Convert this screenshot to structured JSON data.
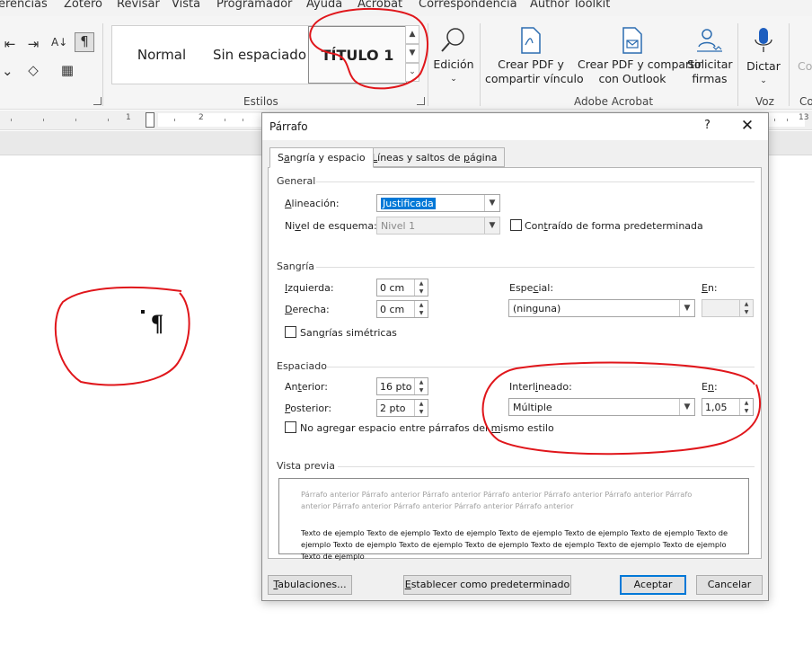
{
  "ribbon_tabs": [
    "erencias",
    "Zotero",
    "Revisar",
    "Vista",
    "Programador",
    "Ayuda",
    "Acrobat",
    "Correspondencia",
    "Author Toolkit"
  ],
  "styles": {
    "items": [
      "Normal",
      "Sin espaciado",
      "TÍTULO 1"
    ],
    "group_label": "Estilos"
  },
  "editing": {
    "label": "Edición"
  },
  "acrobat": {
    "crear_pdf": [
      "Crear PDF y",
      "compartir vínculo"
    ],
    "crear_outlook": [
      "Crear PDF y compartir",
      "con Outlook"
    ],
    "solicitar": [
      "Solicitar",
      "firmas"
    ],
    "group_label": "Adobe Acrobat"
  },
  "voice": {
    "dictar": "Dictar",
    "group_label": "Voz",
    "cut_label": "Co",
    "cut_label2": "Co"
  },
  "ruler": {
    "left_num": "1",
    "right_num": "13",
    "n2": "2"
  },
  "document": {
    "pilcrow": "¶"
  },
  "dialog": {
    "title": "Párrafo",
    "help": "?",
    "close": "✕",
    "tabs": {
      "indent_pre": "S",
      "indent_u": "a",
      "indent_post": "ngría y espacio",
      "lines_pre": "L",
      "lines_u": "í",
      "lines_post": "neas y saltos de ",
      "lines_u2": "p",
      "lines_post2": "ágina"
    },
    "general": {
      "heading": "General",
      "alignment_label_u": "A",
      "alignment_label": "lineación:",
      "alignment_value": "Justificada",
      "outline_label_pre": "Ni",
      "outline_label_u": "v",
      "outline_label": "el de esquema:",
      "outline_value": "Nivel 1",
      "collapsed_pre": "Con",
      "collapsed_u": "t",
      "collapsed_label": "raído de forma predeterminada"
    },
    "indent": {
      "heading": "Sangría",
      "left_label_u": "I",
      "left_label": "zquierda:",
      "left_value": "0 cm",
      "right_label_u": "D",
      "right_label": "erecha:",
      "right_value": "0 cm",
      "special_label_pre": "Espe",
      "special_label_u": "c",
      "special_label": "ial:",
      "special_value": "(ninguna)",
      "by_label_u": "E",
      "by_label": "n:",
      "mirror_pre": "San",
      "mirror_u": "g",
      "mirror_label": "rías simétricas"
    },
    "spacing": {
      "heading": "Espaciado",
      "before_label_pre": "An",
      "before_label_u": "t",
      "before_label": "erior:",
      "before_value": "16 pto",
      "after_label_u": "P",
      "after_label": "osterior:",
      "after_value": "2 pto",
      "line_label_pre": "Interl",
      "line_label_u": "i",
      "line_label": "neado:",
      "line_value": "Múltiple",
      "at_label_pre": "E",
      "at_label_u": "n",
      "at_label": ":",
      "at_value": "1,05",
      "nospace_pre": "No agregar espacio entre párrafos del ",
      "nospace_u": "m",
      "nospace_label": "ismo estilo"
    },
    "preview": {
      "heading": "Vista previa",
      "previous": "Párrafo anterior Párrafo anterior Párrafo anterior Párrafo anterior Párrafo anterior Párrafo anterior Párrafo anterior Párrafo anterior Párrafo anterior Párrafo anterior Párrafo anterior",
      "sample": "Texto de ejemplo Texto de ejemplo Texto de ejemplo Texto de ejemplo Texto de ejemplo Texto de ejemplo Texto de ejemplo Texto de ejemplo Texto de ejemplo Texto de ejemplo Texto de ejemplo Texto de ejemplo Texto de ejemplo Texto de ejemplo"
    },
    "buttons": {
      "tabs_u": "T",
      "tabs": "abulaciones...",
      "default_u": "E",
      "default": "stablecer como predeterminado",
      "ok": "Aceptar",
      "cancel": "Cancelar"
    }
  },
  "colors": {
    "annotation": "#e0161b",
    "selection": "#0078d7"
  }
}
